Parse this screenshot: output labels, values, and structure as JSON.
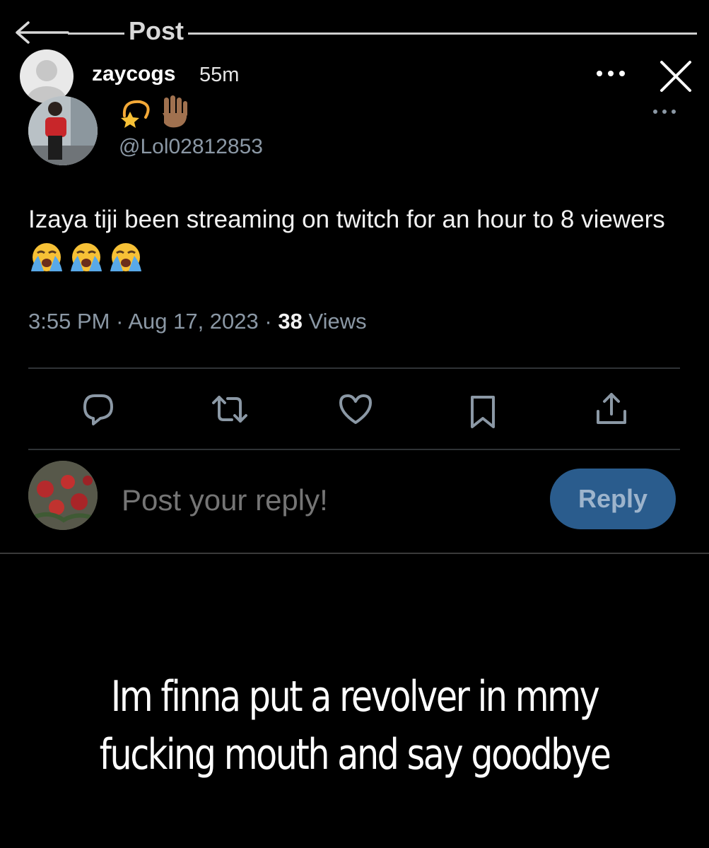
{
  "header": {
    "title": "Post"
  },
  "story": {
    "username": "zaycogs",
    "time_ago": "55m"
  },
  "author": {
    "display_emojis": [
      "dizzy-star-emoji",
      "raised-hand-emoji"
    ],
    "handle": "@Lol02812853"
  },
  "tweet": {
    "text": "Izaya tiji been streaming on twitch for an hour to 8 viewers",
    "trailing_emojis": [
      "loudly-crying-face",
      "loudly-crying-face",
      "loudly-crying-face"
    ],
    "time": "3:55 PM",
    "date": "Aug 17, 2023",
    "views_count": "38",
    "views_label": "Views"
  },
  "reply": {
    "placeholder": "Post your reply!",
    "button_label": "Reply"
  },
  "caption": {
    "line1": "Im finna put a revolver in mmy",
    "line2": "fucking mouth and say goodbye"
  },
  "colors": {
    "background": "#000000",
    "muted_text": "#8b98a5",
    "divider": "#2f3336",
    "reply_button": "#2a5c8d"
  }
}
